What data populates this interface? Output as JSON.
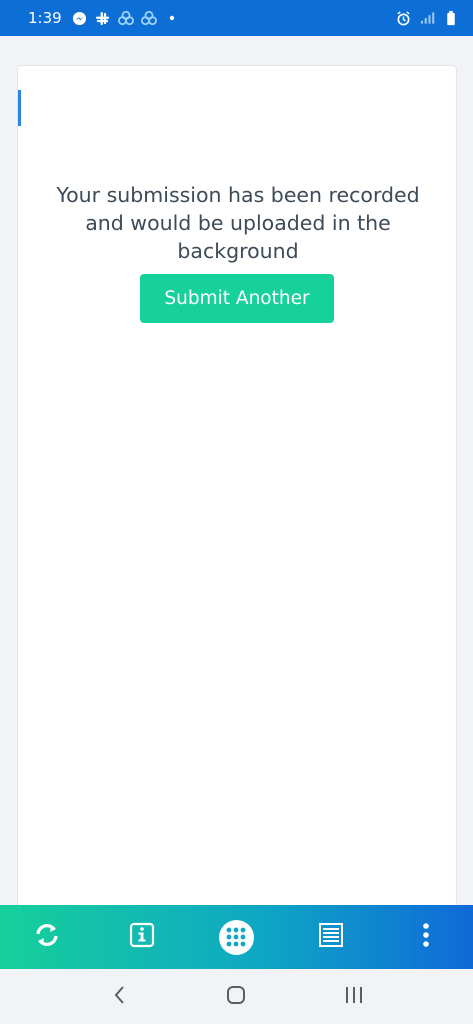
{
  "status_bar": {
    "time": "1:39",
    "left_icons": [
      "messenger-icon",
      "slack-icon",
      "cloud-sync-icon",
      "cloud-sync-icon",
      "dot-icon"
    ],
    "right_icons": [
      "alarm-icon",
      "signal-icon",
      "battery-icon"
    ],
    "background_color": "#0d6fd6"
  },
  "card": {
    "message": "Your submission has been recorded and would be uploaded in the background",
    "submit_button_label": "Submit Another",
    "button_color": "#17d19a"
  },
  "toolbar": {
    "items": [
      "sync-icon",
      "info-icon",
      "apps-grid-icon",
      "list-icon",
      "more-vertical-icon"
    ],
    "gradient": [
      "#16d09a",
      "#1069d8"
    ]
  },
  "nav_bar": {
    "items": [
      "back-icon",
      "home-icon",
      "recents-icon"
    ]
  }
}
